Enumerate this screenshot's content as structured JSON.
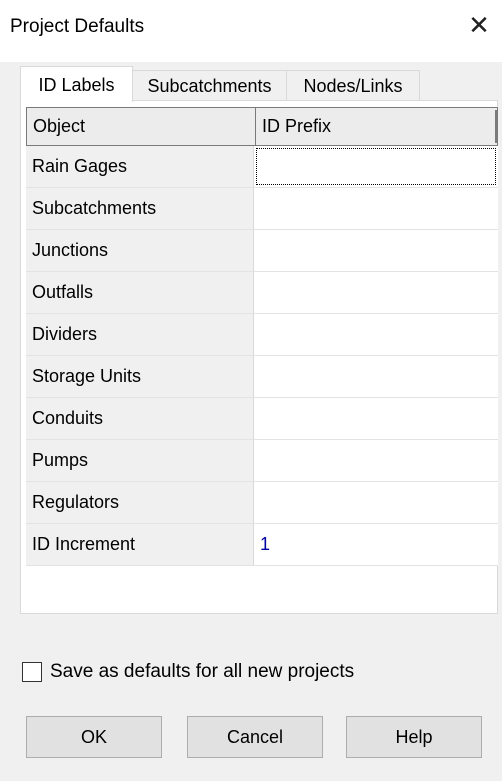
{
  "window": {
    "title": "Project Defaults",
    "close_glyph": "✕"
  },
  "tabs": [
    {
      "label": "ID Labels",
      "active": true
    },
    {
      "label": "Subcatchments",
      "active": false
    },
    {
      "label": "Nodes/Links",
      "active": false
    }
  ],
  "grid": {
    "headers": [
      "Object",
      "ID Prefix"
    ],
    "rows": [
      {
        "object": "Rain Gages",
        "value": ""
      },
      {
        "object": "Subcatchments",
        "value": ""
      },
      {
        "object": "Junctions",
        "value": ""
      },
      {
        "object": "Outfalls",
        "value": ""
      },
      {
        "object": "Dividers",
        "value": ""
      },
      {
        "object": "Storage Units",
        "value": ""
      },
      {
        "object": "Conduits",
        "value": ""
      },
      {
        "object": "Pumps",
        "value": ""
      },
      {
        "object": "Regulators",
        "value": ""
      },
      {
        "object": "ID Increment",
        "value": "1"
      }
    ]
  },
  "checkbox": {
    "label": "Save as defaults for all new projects",
    "checked": false
  },
  "buttons": {
    "ok": "OK",
    "cancel": "Cancel",
    "help": "Help"
  }
}
